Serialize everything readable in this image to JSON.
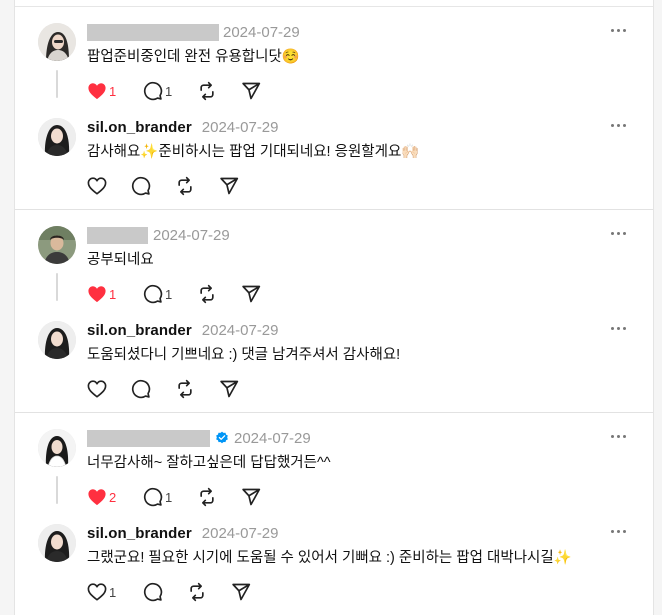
{
  "colors": {
    "like_active": "#ff3040",
    "verified_blue": "#0095f6",
    "date_gray": "#999999",
    "masked_name_gray": "#c9c9c9"
  },
  "icons": [
    "heart-icon",
    "comment-icon",
    "repost-icon",
    "share-icon",
    "more-icon",
    "verified-badge-icon"
  ],
  "threads": [
    {
      "comment": {
        "date": "2024-07-29",
        "text": "팝업준비중인데 완전 유용합니닷☺️",
        "likes": "1",
        "liked": true,
        "replies": "1"
      },
      "reply": {
        "username": "sil.on_brander",
        "date": "2024-07-29",
        "text": "감사해요✨준비하시는 팝업 기대되네요! 응원할게요🙌🏻",
        "likes": "",
        "replies": ""
      }
    },
    {
      "comment": {
        "date": "2024-07-29",
        "text": "공부되네요",
        "likes": "1",
        "liked": true,
        "replies": "1"
      },
      "reply": {
        "username": "sil.on_brander",
        "date": "2024-07-29",
        "text": "도움되셨다니 기쁘네요 :) 댓글 남겨주셔서 감사해요!",
        "likes": "",
        "replies": ""
      }
    },
    {
      "comment": {
        "date": "2024-07-29",
        "text": "너무감사해~ 잘하고싶은데 답답했거든^^",
        "likes": "2",
        "liked": true,
        "replies": "1",
        "verified": true
      },
      "reply": {
        "username": "sil.on_brander",
        "date": "2024-07-29",
        "text": "그랬군요! 필요한 시기에 도움될 수 있어서 기뻐요 :) 준비하는 팝업 대박나시길✨",
        "likes": "1",
        "replies": ""
      }
    }
  ]
}
